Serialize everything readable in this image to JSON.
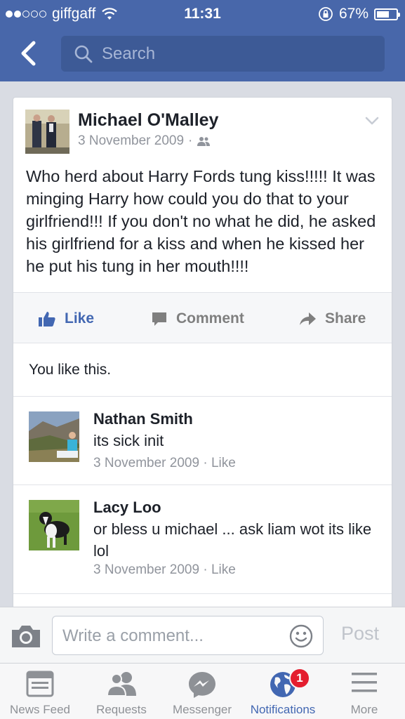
{
  "status": {
    "carrier": "giffgaff",
    "time": "11:31",
    "battery": "67%",
    "battery_level": 0.67
  },
  "header": {
    "search_placeholder": "Search"
  },
  "post": {
    "author": "Michael O'Malley",
    "date": "3 November 2009",
    "meta_separator": "·",
    "text": "Who herd about Harry Fords tung kiss!!!!! It was minging Harry how could you do that to your girlfriend!!! If you don't no what he did, he asked his girlfriend for a kiss and when he kissed her he put his tung in her mouth!!!!"
  },
  "actions": {
    "like": "Like",
    "comment": "Comment",
    "share": "Share"
  },
  "likes_summary": "You like this.",
  "comments": [
    {
      "name": "Nathan Smith",
      "text": "its sick init",
      "date": "3 November 2009",
      "like": "Like",
      "sep": "·"
    },
    {
      "name": "Lacy Loo",
      "text": "or bless u michael ... ask liam wot its like lol",
      "date": "3 November 2009",
      "like": "Like",
      "sep": "·"
    }
  ],
  "composer": {
    "placeholder": "Write a comment...",
    "post_label": "Post"
  },
  "tabs": [
    {
      "label": "News Feed"
    },
    {
      "label": "Requests"
    },
    {
      "label": "Messenger"
    },
    {
      "label": "Notifications",
      "badge": "1"
    },
    {
      "label": "More"
    }
  ],
  "colors": {
    "brand": "#4867aa",
    "link": "#4267b2",
    "badge": "#e41e2f"
  }
}
